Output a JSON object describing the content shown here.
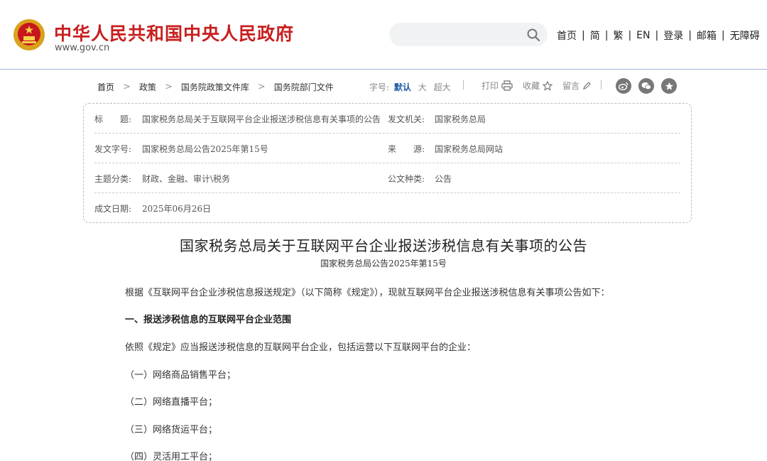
{
  "header": {
    "title": "中华人民共和国中央人民政府",
    "domain": "www.gov.cn",
    "search_placeholder": "",
    "links": [
      "首页",
      "简",
      "繁",
      "EN",
      "登录",
      "邮箱",
      "无障碍"
    ],
    "brand_color": "#c81f1f"
  },
  "toolbar": {
    "breadcrumbs": [
      "首页",
      "政策",
      "国务院政策文件库",
      "国务院部门文件"
    ],
    "font_label": "字号:",
    "font_options": [
      "默认",
      "大",
      "超大"
    ],
    "print_label": "打印",
    "favorite_label": "收藏",
    "comment_label": "留言",
    "share_icons": [
      "weibo-icon",
      "wechat-icon",
      "star-icon"
    ]
  },
  "info": {
    "title_label": "标　　题:",
    "title_value": "国家税务总局关于互联网平台企业报送涉税信息有关事项的公告",
    "issuer_label": "发文机关:",
    "issuer_value": "国家税务总局",
    "docno_label": "发文字号:",
    "docno_value": "国家税务总局公告2025年第15号",
    "source_label": "来　　源:",
    "source_value": "国家税务总局网站",
    "topic_label": "主题分类:",
    "topic_value": "财政、金融、审计\\税务",
    "type_label": "公文种类:",
    "type_value": "公告",
    "date_label": "成文日期:",
    "date_value": "2025年06月26日"
  },
  "article": {
    "title": "国家税务总局关于互联网平台企业报送涉税信息有关事项的公告",
    "doc_number": "国家税务总局公告2025年第15号",
    "paragraphs": [
      "根据《互联网平台企业涉税信息报送规定》（以下简称《规定》），现就互联网平台企业报送涉税信息有关事项公告如下：",
      "一、报送涉税信息的互联网平台企业范围",
      "依照《规定》应当报送涉税信息的互联网平台企业，包括运营以下互联网平台的企业：",
      "（一）网络商品销售平台；",
      "（二）网络直播平台；",
      "（三）网络货运平台；",
      "（四）灵活用工平台；"
    ]
  }
}
